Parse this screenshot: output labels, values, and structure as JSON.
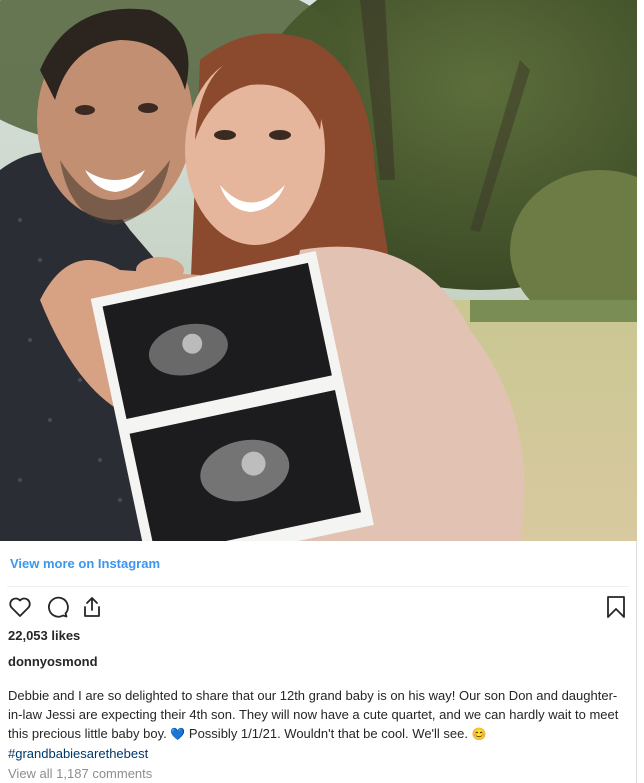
{
  "post": {
    "image_alt": "Couple holding ultrasound photos outdoors",
    "view_more_label": "View more on Instagram",
    "likes": "22,053 likes",
    "username": "donnyosmond",
    "caption_text": "Debbie and I are so delighted to share that our 12th grand baby is on his way! Our son Don and daughter-in-law Jessi are expecting their 4th son. They will now have a cute quartet, and we can hardly wait to meet this precious little baby boy. ",
    "caption_emoji_heart": "💙",
    "caption_text_2": " Possibly 1/1/21. Wouldn't that be cool. We'll see. ",
    "caption_emoji_smile": "😊",
    "hashtag": "#grandbabiesarethebest",
    "comments_link": "View all 1,187 comments"
  },
  "icons": {
    "like": "heart-icon",
    "comment": "comment-icon",
    "share": "share-icon",
    "save": "bookmark-icon"
  },
  "colors": {
    "link_blue": "#3897f0",
    "hashtag": "#00376b",
    "muted": "#8e8e8e",
    "text": "#262626"
  }
}
